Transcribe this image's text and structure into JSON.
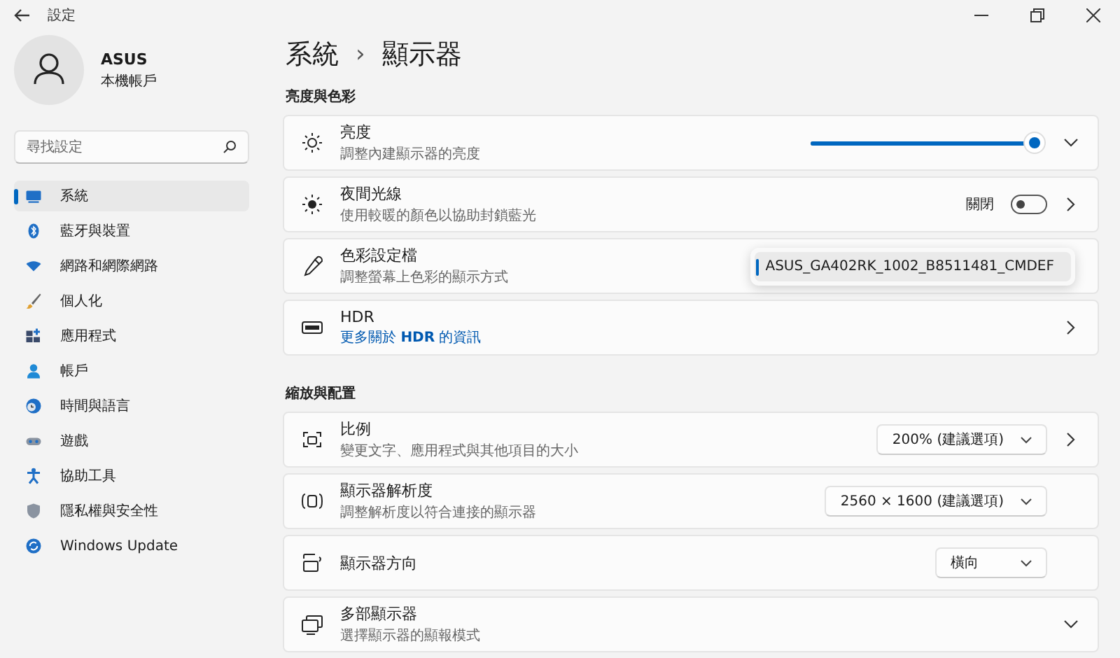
{
  "window": {
    "title": "設定"
  },
  "account": {
    "name": "ASUS",
    "type": "本機帳戶"
  },
  "search": {
    "placeholder": "尋找設定"
  },
  "sidebar": {
    "items": [
      {
        "label": "系統",
        "selected": true
      },
      {
        "label": "藍牙與裝置",
        "selected": false
      },
      {
        "label": "網路和網際網路",
        "selected": false
      },
      {
        "label": "個人化",
        "selected": false
      },
      {
        "label": "應用程式",
        "selected": false
      },
      {
        "label": "帳戶",
        "selected": false
      },
      {
        "label": "時間與語言",
        "selected": false
      },
      {
        "label": "遊戲",
        "selected": false
      },
      {
        "label": "協助工具",
        "selected": false
      },
      {
        "label": "隱私權與安全性",
        "selected": false
      },
      {
        "label": "Windows Update",
        "selected": false
      }
    ]
  },
  "breadcrumb": {
    "parent": "系統",
    "separator": "›",
    "current": "顯示器"
  },
  "sections": [
    {
      "title": "亮度與色彩",
      "rows": [
        {
          "kind": "slider",
          "title": "亮度",
          "subtitle": "調整內建顯示器的亮度",
          "level": 1.0,
          "expandable": true,
          "navigates": false
        },
        {
          "kind": "toggle",
          "title": "夜間光線",
          "subtitle": "使用較暖的顏色以協助封鎖藍光",
          "state_label": "關閉",
          "on": false,
          "expandable": false,
          "navigates": true
        },
        {
          "kind": "popup",
          "title": "色彩設定檔",
          "subtitle": "調整螢幕上色彩的顯示方式",
          "options": [
            {
              "label": "ASUS_GA402RK_1002_B8511481_CMDEF",
              "selected": true
            }
          ],
          "expandable": false,
          "navigates": false
        },
        {
          "kind": "link",
          "title": "HDR",
          "link": "更多關於 **HDR** 的資訊",
          "expandable": false,
          "navigates": true
        }
      ]
    },
    {
      "title": "縮放與配置",
      "rows": [
        {
          "kind": "dropdown",
          "title": "比例",
          "subtitle": "變更文字、應用程式與其他項目的大小",
          "value": "200% (建議選項)",
          "expandable": false,
          "navigates": true
        },
        {
          "kind": "dropdown",
          "title": "顯示器解析度",
          "subtitle": "調整解析度以符合連接的顯示器",
          "value": "2560 × 1600 (建議選項)",
          "expandable": false,
          "navigates": false
        },
        {
          "kind": "dropdown",
          "title": "顯示器方向",
          "value": "橫向",
          "expandable": false,
          "navigates": false
        },
        {
          "kind": "plain",
          "title": "多部顯示器",
          "subtitle": "選擇顯示器的顯報模式",
          "expandable": true,
          "navigates": false
        }
      ]
    }
  ]
}
